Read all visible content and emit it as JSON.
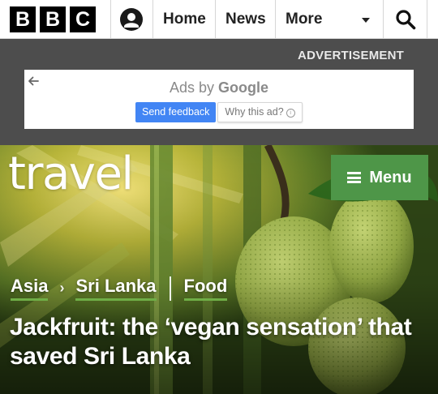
{
  "header": {
    "logo_letters": [
      "B",
      "B",
      "C"
    ],
    "nav": [
      {
        "label": "Home"
      },
      {
        "label": "News"
      },
      {
        "label": "More"
      }
    ],
    "account_icon": "account-icon",
    "search_icon": "search-icon"
  },
  "ad": {
    "label": "ADVERTISEMENT",
    "ads_by_prefix": "Ads by",
    "ads_by_brand": "Google",
    "send_feedback": "Send feedback",
    "why_this_ad": "Why this ad?",
    "info_glyph": "i",
    "back_icon": "back-arrow-icon"
  },
  "hero": {
    "section_logo": "travel",
    "menu_label": "Menu",
    "breadcrumb": [
      {
        "label": "Asia"
      },
      {
        "label": "Sri Lanka"
      },
      {
        "label": "Food"
      }
    ],
    "headline": "Jackfruit: the ‘vegan sensation’ that saved Sri Lanka"
  },
  "colors": {
    "menu_green": "#4e9648",
    "crumb_underline": "#6fae47",
    "ad_background": "#4d4d4d",
    "feedback_blue": "#4285f4"
  }
}
